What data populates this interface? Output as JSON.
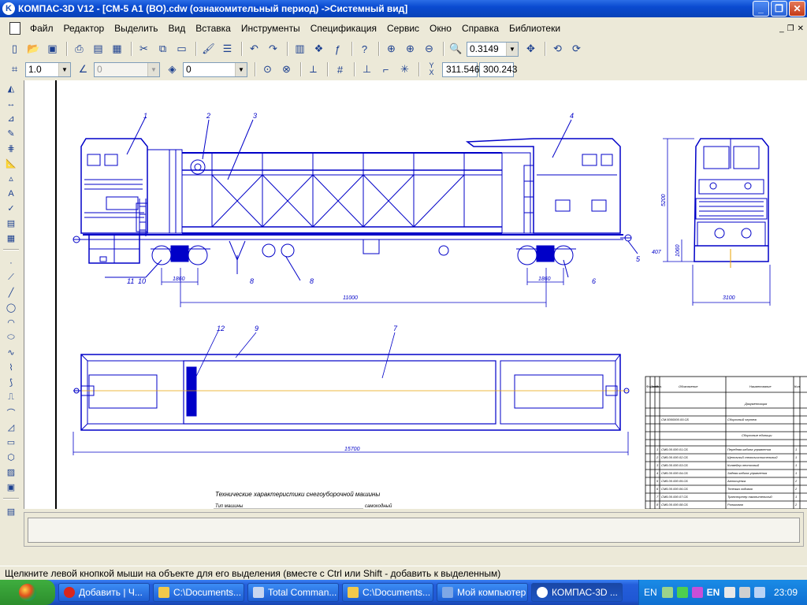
{
  "window": {
    "title": "КОМПАС-3D V12 - [СМ-5 А1 (ВО).cdw (ознакомительный период) ->Системный вид]",
    "app_icon_letter": "K"
  },
  "menu": [
    "Файл",
    "Редактор",
    "Выделить",
    "Вид",
    "Вставка",
    "Инструменты",
    "Спецификация",
    "Сервис",
    "Окно",
    "Справка",
    "Библиотеки"
  ],
  "toolbar": {
    "zoom_value": "0.3149",
    "line_step": "1.0",
    "angle": "0",
    "layer": "0",
    "coord_x": "311.546",
    "coord_y": "300.243",
    "coord_label": "Y\nX"
  },
  "drawing": {
    "side_view_callouts": [
      "1",
      "2",
      "3",
      "4",
      "11",
      "10",
      "8",
      "8",
      "6",
      "5"
    ],
    "top_view_callouts": [
      "12",
      "9",
      "7"
    ],
    "dims": {
      "bogie_base_left": "1860",
      "bogie_base_right": "1860",
      "center_distance": "11000",
      "overall_length": "15700",
      "front_height": "5200",
      "front_lower": "1060",
      "front_wheel": "407",
      "front_width": "3100"
    },
    "tech_title": "Технические характеристики снегоуборочной машины",
    "tech_line1": "Тип машины",
    "tech_line1_value": "самоходный",
    "spec_table": {
      "headers": [
        "Формат",
        "Зона",
        "Поз.",
        "Обозначение",
        "Наименование",
        "Кол."
      ],
      "section1": "Документация",
      "doc_row": {
        "designation": "СМ.5000000.00.СБ",
        "name": "Сборочный чертеж"
      },
      "section2": "Сборочные единицы",
      "rows": [
        {
          "pos": "1",
          "designation": "СМ5.00.000.01.СБ",
          "name": "Передняя кабина управления",
          "qty": "1"
        },
        {
          "pos": "2",
          "designation": "СМ5.00.000.02.СБ",
          "name": "Щеточный снегоочистительный",
          "qty": "1"
        },
        {
          "pos": "3",
          "designation": "СМ5.00.000.03.СБ",
          "name": "Конвейер ленточный",
          "qty": "1"
        },
        {
          "pos": "4",
          "designation": "СМ5.00.000.04.СБ",
          "name": "Задняя кабина управления",
          "qty": "1"
        },
        {
          "pos": "5",
          "designation": "СМ5.00.000.05.СБ",
          "name": "Автосцепка",
          "qty": "2"
        },
        {
          "pos": "6",
          "designation": "СМ5.00.000.06.СБ",
          "name": "Тележка ходовая",
          "qty": "2"
        },
        {
          "pos": "7",
          "designation": "СМ5.00.000.07.СБ",
          "name": "Транспортер накопительный",
          "qty": "1"
        },
        {
          "pos": "8",
          "designation": "СМ5.00.000.08.СБ",
          "name": "Роликовая",
          "qty": "2"
        },
        {
          "pos": "9",
          "designation": "СМ5.00.000.09.СБ",
          "name": "Рама",
          "qty": "1"
        }
      ]
    }
  },
  "status": "Щелкните левой кнопкой мыши на объекте для его выделения (вместе с Ctrl или Shift - добавить к выделенным)",
  "taskbar": {
    "tasks": [
      {
        "label": "Добавить | Ч...",
        "color": "#d9261c"
      },
      {
        "label": "C:\\Documents...",
        "color": "#f2c94c"
      },
      {
        "label": "Total Comman...",
        "color": "#c8d6f0"
      },
      {
        "label": "C:\\Documents...",
        "color": "#f2c94c"
      },
      {
        "label": "Мой компьютер",
        "color": "#7ea7e6"
      },
      {
        "label": "КОМПАС-3D ...",
        "color": "#ffffff"
      }
    ],
    "lang1": "EN",
    "lang2": "EN",
    "clock": "23:09"
  },
  "colors": {
    "drawing_blue": "#0000c8",
    "axis_orange": "#e8a000"
  }
}
